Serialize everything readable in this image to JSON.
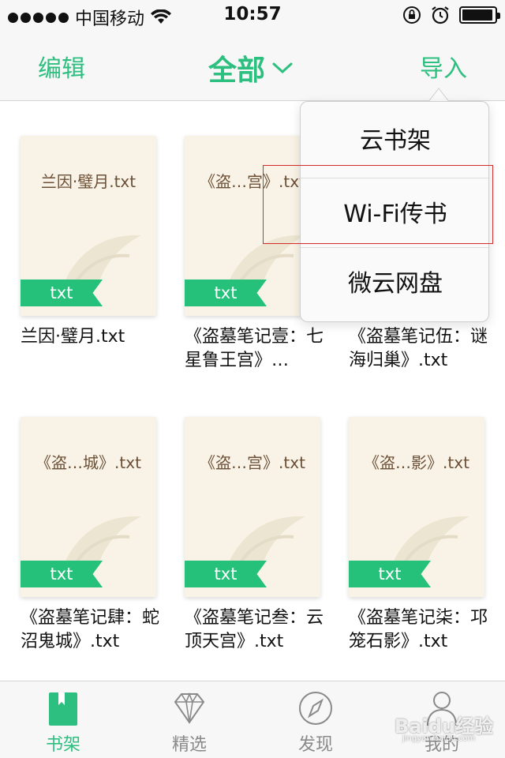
{
  "status_bar": {
    "carrier": "中国移动",
    "time": "10:57",
    "icons": [
      "signal-dots-icon",
      "wifi-icon",
      "rotation-lock-icon",
      "alarm-icon",
      "battery-icon"
    ]
  },
  "navbar": {
    "edit": "编辑",
    "title": "全部",
    "import": "导入"
  },
  "popover_menu": {
    "items": [
      {
        "label": "云书架"
      },
      {
        "label": "Wi-Fi传书"
      },
      {
        "label": "微云网盘"
      }
    ]
  },
  "books": [
    {
      "cover_title": "兰因·璧月.txt",
      "badge": "txt",
      "name": "兰因·璧月.txt"
    },
    {
      "cover_title": "《盗…宫》.txt",
      "badge": "txt",
      "name": "《盗墓笔记壹：七星鲁王宫》…"
    },
    {
      "cover_title": "",
      "badge": "",
      "name": "《盗墓笔记伍：谜海归巢》.txt"
    },
    {
      "cover_title": "《盗…城》.txt",
      "badge": "txt",
      "name": "《盗墓笔记肆：蛇沼鬼城》.txt"
    },
    {
      "cover_title": "《盗…宫》.txt",
      "badge": "txt",
      "name": "《盗墓笔记叁：云顶天宫》.txt"
    },
    {
      "cover_title": "《盗…影》.txt",
      "badge": "txt",
      "name": "《盗墓笔记柒：邛笼石影》.txt"
    }
  ],
  "tabbar": {
    "tabs": [
      {
        "label": "书架",
        "icon": "bookshelf-icon",
        "active": true
      },
      {
        "label": "精选",
        "icon": "diamond-icon",
        "active": false
      },
      {
        "label": "发现",
        "icon": "compass-icon",
        "active": false
      },
      {
        "label": "我的",
        "icon": "profile-icon",
        "active": false
      }
    ]
  },
  "watermark": {
    "text": "Baidu经验",
    "sub": "jingyan.baidu.com"
  },
  "colors": {
    "accent": "#2dbf7f",
    "ribbon": "#25c07a",
    "cover": "#f8f3e6"
  }
}
